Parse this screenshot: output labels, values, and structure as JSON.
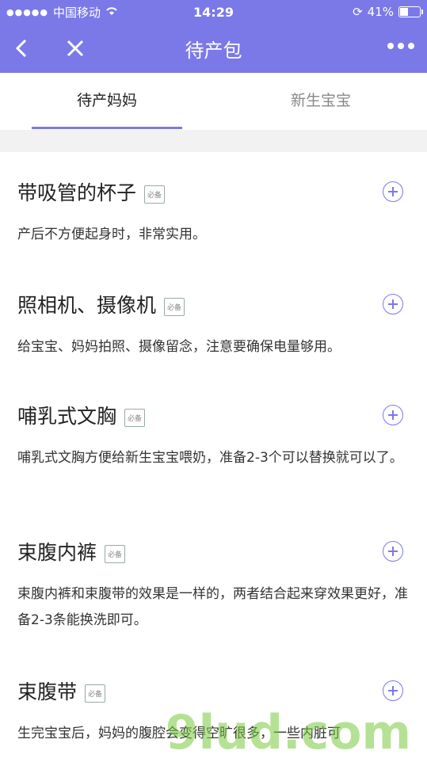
{
  "status": {
    "carrier": "中国移动",
    "time": "14:29",
    "battery": "41%"
  },
  "nav": {
    "title": "待产包"
  },
  "tabs": [
    {
      "label": "待产妈妈"
    },
    {
      "label": "新生宝宝"
    }
  ],
  "badge": "必备",
  "items": [
    {
      "title": "带吸管的杯子",
      "desc": " 产后不方便起身时，非常实用。"
    },
    {
      "title": "照相机、摄像机",
      "desc": "给宝宝、妈妈拍照、摄像留念，注意要确保电量够用。"
    },
    {
      "title": "哺乳式文胸",
      "desc": "哺乳式文胸方便给新生宝宝喂奶，准备2-3个可以替换就可以了。"
    },
    {
      "title": "束腹内裤",
      "desc": "束腹内裤和束腹带的效果是一样的，两者结合起来穿效果更好，准备2-3条能换洗即可。"
    },
    {
      "title": "束腹带",
      "desc": "生完宝宝后，妈妈的腹腔会变得空旷很多，一些内脏可"
    }
  ],
  "watermark": "9lud.com"
}
